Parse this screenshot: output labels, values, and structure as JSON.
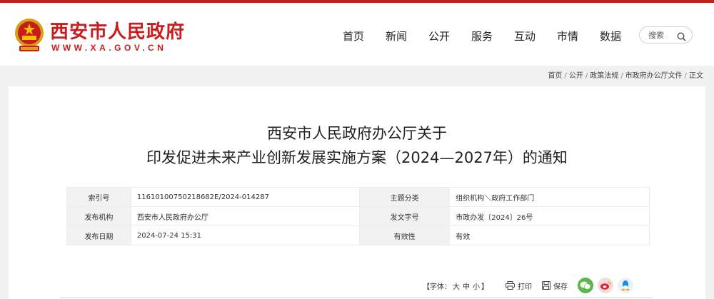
{
  "site": {
    "title": "西安市人民政府",
    "url": "WWW.XA.GOV.CN",
    "brand_color": "#c91c1c"
  },
  "nav": {
    "items": [
      "首页",
      "新闻",
      "公开",
      "服务",
      "互动",
      "市情",
      "数据"
    ]
  },
  "search": {
    "placeholder": "搜索",
    "icon": "search-icon"
  },
  "breadcrumb": {
    "items": [
      "首页",
      "公开",
      "政策法规",
      "市政府办公厅文件",
      "正文"
    ],
    "separator": "/"
  },
  "document": {
    "title_line1": "西安市人民政府办公厅关于",
    "title_line2": "印发促进未来产业创新发展实施方案（2024—2027年）的通知",
    "meta": {
      "index_label": "索引号",
      "index_value": "11610100750218682E/2024-014287",
      "topic_label": "主题分类",
      "topic_value": "组织机构＼政府工作部门",
      "publisher_label": "发布机构",
      "publisher_value": "西安市人民政府办公厅",
      "doc_no_label": "发文字号",
      "doc_no_value": "市政办发〔2024〕26号",
      "date_label": "发布日期",
      "date_value": "2024-07-24 15:31",
      "validity_label": "有效性",
      "validity_value": "有效"
    }
  },
  "tools": {
    "font_prefix": "【字体：",
    "font_large": "大",
    "font_medium": "中",
    "font_small": "小",
    "font_suffix": "】",
    "print_label": "打印",
    "save_label": "保存",
    "share_icons": [
      "wechat-icon",
      "weibo-icon",
      "qq-icon"
    ]
  }
}
